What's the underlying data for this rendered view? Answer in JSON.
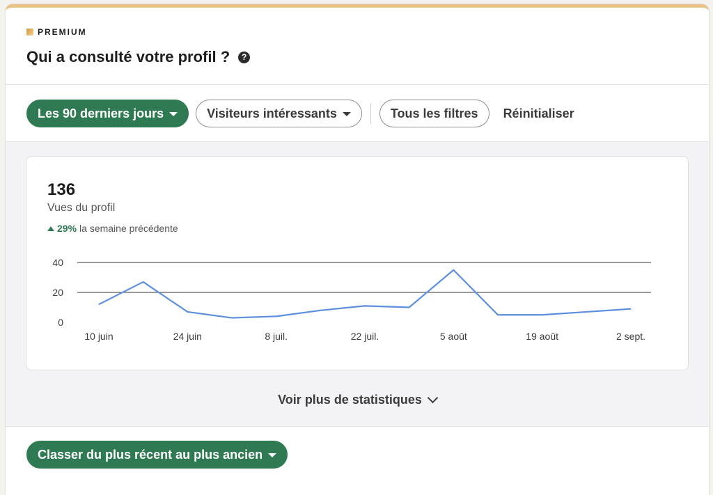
{
  "header": {
    "premium_label": "PREMIUM",
    "title": "Qui a consulté votre profil ?",
    "help_glyph": "?"
  },
  "filters": {
    "period": "Les 90 derniers jours",
    "visitors": "Visiteurs intéressants",
    "all_filters": "Tous les filtres",
    "reset": "Réinitialiser"
  },
  "metric": {
    "value": "136",
    "label": "Vues du profil",
    "change_pct": "29%",
    "change_text": "la semaine précédente"
  },
  "chart_data": {
    "type": "line",
    "x": [
      "10 juin",
      "17 juin",
      "24 juin",
      "1 juil.",
      "8 juil.",
      "15 juil.",
      "22 juil.",
      "29 juil.",
      "5 août",
      "12 août",
      "19 août",
      "26 août",
      "2 sept."
    ],
    "x_tick_labels": [
      "10 juin",
      "24 juin",
      "8 juil.",
      "22 juil.",
      "5 août",
      "19 août",
      "2 sept."
    ],
    "series": [
      {
        "values": [
          12,
          27,
          7,
          3,
          4,
          8,
          11,
          10,
          35,
          5,
          5,
          7,
          9
        ]
      }
    ],
    "y_ticks": [
      "0",
      "20",
      "40"
    ],
    "ylim": [
      0,
      40
    ],
    "grid": true,
    "line_color": "#5b8fdd"
  },
  "see_more": "Voir plus de statistiques",
  "sort": {
    "label": "Classer du plus récent au plus ancien"
  },
  "colors": {
    "accent_green": "#2f7a53",
    "premium_gold": "#e9c187"
  }
}
